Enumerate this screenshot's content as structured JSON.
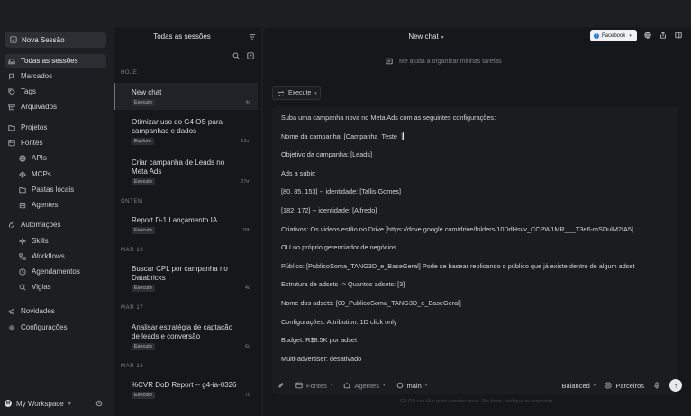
{
  "nav": {
    "new_session": "Nova Sessão",
    "items": [
      {
        "label": "Todas as sessões",
        "icon": "inbox-icon"
      },
      {
        "label": "Marcados",
        "icon": "flag-icon"
      },
      {
        "label": "Tags",
        "icon": "tag-icon"
      },
      {
        "label": "Arquivados",
        "icon": "archive-icon"
      },
      {
        "label": "Projetos",
        "icon": "folder-icon"
      },
      {
        "label": "Fontes",
        "icon": "database-icon"
      },
      {
        "label": "APIs",
        "icon": "globe-icon"
      },
      {
        "label": "MCPs",
        "icon": "network-icon"
      },
      {
        "label": "Pastas locais",
        "icon": "folder-icon"
      },
      {
        "label": "Agentes",
        "icon": "bot-icon"
      },
      {
        "label": "Automações",
        "icon": "automation-icon"
      },
      {
        "label": "Skills",
        "icon": "sparkle-icon"
      },
      {
        "label": "Workflows",
        "icon": "workflow-icon"
      },
      {
        "label": "Agendamentos",
        "icon": "clock-icon"
      },
      {
        "label": "Vigias",
        "icon": "watch-icon"
      },
      {
        "label": "Novidades",
        "icon": "megaphone-icon"
      },
      {
        "label": "Configurações",
        "icon": "gear-icon"
      }
    ],
    "workspace": "My Workspace"
  },
  "sessions": {
    "title": "Todas as sessões",
    "groups": [
      "HOJE",
      "ONTEM",
      "MAR 19",
      "MAR 17",
      "MAR 16"
    ],
    "items": [
      {
        "title": "New chat",
        "badge": "Execute",
        "age": "4s"
      },
      {
        "title": "Otimizar uso do G4 OS para campanhas e dados",
        "badge": "Explore",
        "age": "13m"
      },
      {
        "title": "Criar campanha de Leads no Meta Ads",
        "badge": "Execute",
        "age": "27m"
      },
      {
        "title": "Report D-1 Lançamento IA",
        "badge": "Execute",
        "age": "20h"
      },
      {
        "title": "Buscar CPL por campanha no Databricks",
        "badge": "Execute",
        "age": "4d"
      },
      {
        "title": "Analisar estratégia de captação de leads e conversão",
        "badge": "Execute",
        "age": "6d"
      },
      {
        "title": "%CVR DoD Report -- g4-ia-0326",
        "badge": "Execute",
        "age": "7d"
      }
    ]
  },
  "main": {
    "title": "New chat",
    "connector": "Facebook",
    "suggestion": "Me ajuda a organizar minhas tarefas",
    "mode": "Execute",
    "message_lines": [
      "Suba uma campanha nova no Meta Ads com as seguintes configurações:",
      "Nome da campanha: [Campanha_Teste_]",
      "Objetivo da campanha: [Leads]",
      "Ads a subir:",
      "[80, 85, 153] -- identidade: [Tallis Gomes]",
      "[182, 172] -- identidade: [Alfredo]",
      "Criativos: Os videos estão no Drive [https://drive.google.com/drive/folders/10DdHsvv_CCPW1MR___T3e6-mSDulM2fA5]",
      "OU no próprio gerenciador de negócios",
      "Público: [PublicoSoma_TANG3D_e_BaseGeral] Pode se basear replicando o público que já existe dentro de algum adset",
      "Estrutura de adsets -> Quantos adsets: [3]",
      "Nome dos adsets: [00_PublicoSoma_TANG3D_e_BaseGeral]",
      "Configurações: Attribution: 1D click only",
      "Budget: R$8.5K por adset",
      "Multi-advertiser: desativado"
    ],
    "toolbar": {
      "sources": "Fontes",
      "agents": "Agentes",
      "branch": "main",
      "model": "Balanced",
      "partners": "Parceiros"
    },
    "disclaimer": "G4 OS usa IA e pode cometer erros. Por favor, verifique as respostas."
  }
}
